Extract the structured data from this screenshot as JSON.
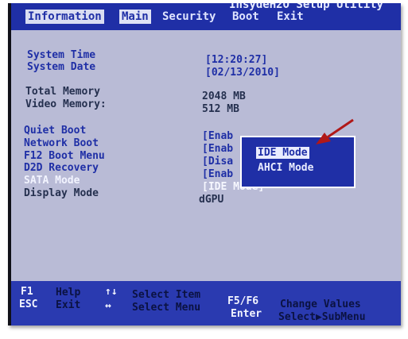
{
  "header": {
    "banner": "InsydeH2O Setup Utility",
    "tabs": [
      {
        "label": "Information"
      },
      {
        "label": "Main"
      },
      {
        "label": "Security"
      },
      {
        "label": "Boot"
      },
      {
        "label": "Exit"
      }
    ]
  },
  "fields": {
    "system_time": {
      "label": "System Time",
      "value": "[12:20:27]"
    },
    "system_date": {
      "label": "System Date",
      "value": "[02/13/2010]"
    },
    "total_memory": {
      "label": "Total Memory",
      "value": "2048 MB"
    },
    "video_memory": {
      "label": "Video Memory:",
      "value": "512 MB"
    },
    "quiet_boot": {
      "label": "Quiet Boot",
      "value": "[Enab"
    },
    "network_boot": {
      "label": "Network Boot",
      "value": "[Enab"
    },
    "f12_boot_menu": {
      "label": "F12 Boot Menu",
      "value": "[Disa"
    },
    "d2d_recovery": {
      "label": "D2D Recovery",
      "value": "[Enab"
    },
    "sata_mode": {
      "label": "SATA Mode",
      "value": "[IDE Mode]"
    },
    "display_mode": {
      "label": "Display Mode",
      "value": "dGPU"
    }
  },
  "popup": {
    "options": [
      "IDE Mode",
      "AHCI Mode"
    ],
    "selected": "IDE Mode"
  },
  "footer": {
    "help": {
      "key": "F1",
      "desc": "Help"
    },
    "exit": {
      "key": "ESC",
      "desc": "Exit"
    },
    "select_item": {
      "key": "↑↓",
      "desc": "Select Item"
    },
    "select_menu": {
      "key": "↔",
      "desc": "Select Menu"
    },
    "change_values": {
      "key": "F5/F6",
      "desc": "Change Values"
    },
    "submenu": {
      "key": "Enter",
      "desc": "Select▶SubMenu"
    }
  },
  "colors": {
    "bios_blue": "#1f2fa6",
    "panel_gray": "#b9bbd6",
    "annotation_arrow": "#b01818"
  }
}
